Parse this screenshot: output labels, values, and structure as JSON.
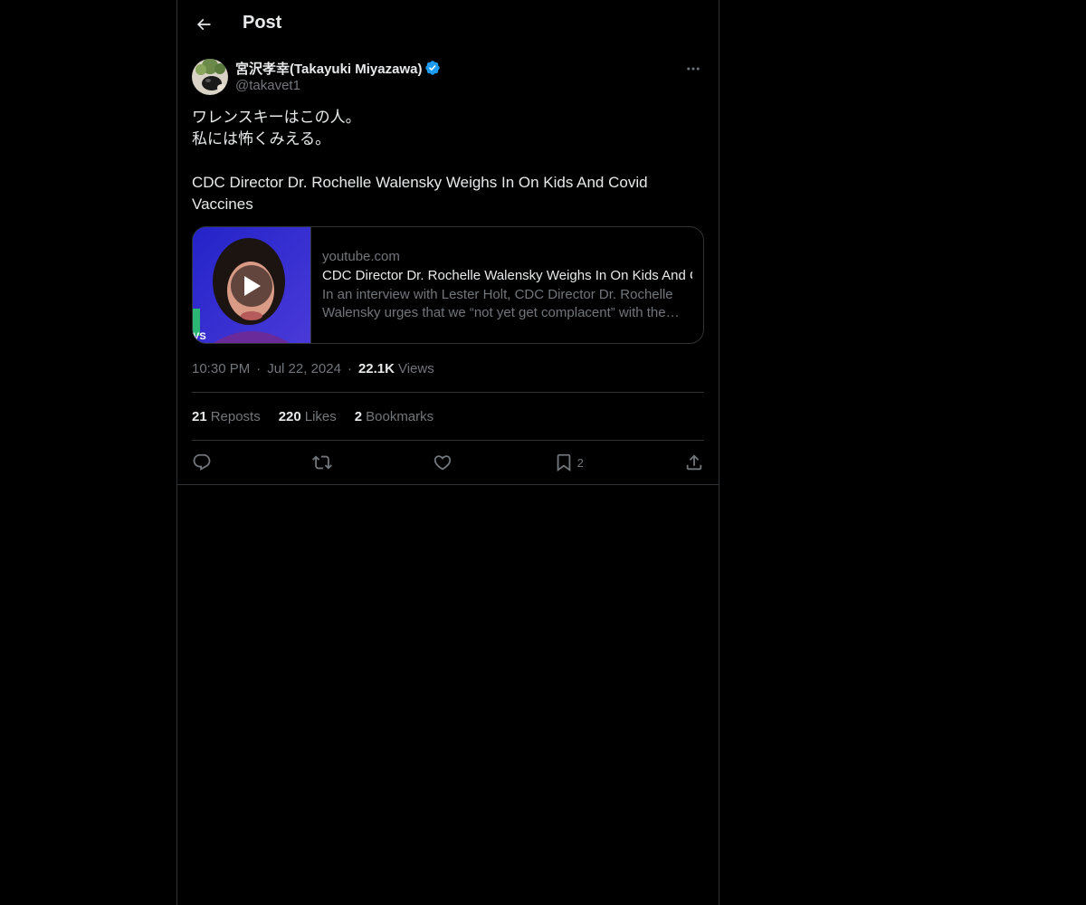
{
  "header": {
    "title": "Post",
    "back_icon": "arrow-left-icon"
  },
  "author": {
    "display_name": "宮沢孝幸(Takayuki Miyazawa)",
    "handle": "@takavet1",
    "verified": true,
    "verified_color": "#1d9bf0"
  },
  "post": {
    "text": "ワレンスキーはこの人。\n私には怖くみえる。\n\nCDC Director Dr. Rochelle Walensky Weighs In On Kids And Covid Vaccines"
  },
  "card": {
    "domain": "youtube.com",
    "title": "CDC Director Dr. Rochelle Walensky Weighs In On Kids And Covid Vaccines",
    "description": "In an interview with Lester Holt, CDC Director Dr. Rochelle Walensky urges that we “not yet get complacent” with the pandemic."
  },
  "meta": {
    "time": "10:30 PM",
    "date": "Jul 22, 2024",
    "views_count": "22.1K",
    "views_label": "Views"
  },
  "stats": {
    "reposts_count": "21",
    "reposts_label": "Reposts",
    "likes_count": "220",
    "likes_label": "Likes",
    "bookmarks_count": "2",
    "bookmarks_label": "Bookmarks"
  },
  "actions": {
    "bookmark_count": "2"
  },
  "colors": {
    "background": "#000000",
    "text": "#e7e9ea",
    "secondary": "#71767b",
    "border": "#2f3336"
  }
}
